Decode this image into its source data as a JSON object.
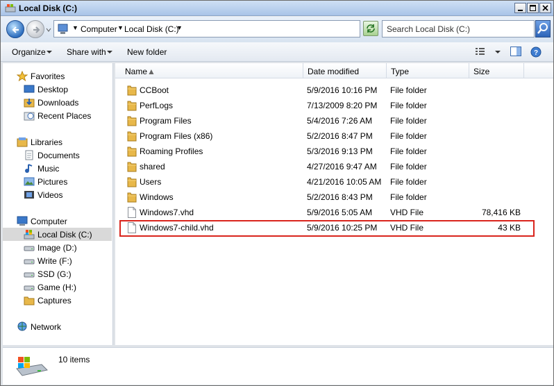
{
  "window": {
    "title": "Local Disk (C:)"
  },
  "address": {
    "crumbs": [
      "Computer",
      "Local Disk (C:)"
    ]
  },
  "search": {
    "placeholder": "Search Local Disk (C:)"
  },
  "toolbar": {
    "organize": "Organize",
    "share_with": "Share with",
    "new_folder": "New folder"
  },
  "nav": {
    "favorites": "Favorites",
    "desktop": "Desktop",
    "downloads": "Downloads",
    "recent_places": "Recent Places",
    "libraries": "Libraries",
    "documents": "Documents",
    "music": "Music",
    "pictures": "Pictures",
    "videos": "Videos",
    "computer": "Computer",
    "local_disk": "Local Disk (C:)",
    "image_d": "Image (D:)",
    "write_f": "Write (F:)",
    "ssd_g": "SSD (G:)",
    "game_h": "Game (H:)",
    "captures": "Captures",
    "network": "Network"
  },
  "columns": {
    "name": "Name",
    "date_modified": "Date modified",
    "type": "Type",
    "size": "Size"
  },
  "files": [
    {
      "name": "CCBoot",
      "date": "5/9/2016 10:16 PM",
      "type": "File folder",
      "size": "",
      "kind": "folder"
    },
    {
      "name": "PerfLogs",
      "date": "7/13/2009 8:20 PM",
      "type": "File folder",
      "size": "",
      "kind": "folder"
    },
    {
      "name": "Program Files",
      "date": "5/4/2016 7:26 AM",
      "type": "File folder",
      "size": "",
      "kind": "folder"
    },
    {
      "name": "Program Files (x86)",
      "date": "5/2/2016 8:47 PM",
      "type": "File folder",
      "size": "",
      "kind": "folder"
    },
    {
      "name": "Roaming Profiles",
      "date": "5/3/2016 9:13 PM",
      "type": "File folder",
      "size": "",
      "kind": "folder"
    },
    {
      "name": "shared",
      "date": "4/27/2016 9:47 AM",
      "type": "File folder",
      "size": "",
      "kind": "folder"
    },
    {
      "name": "Users",
      "date": "4/21/2016 10:05 AM",
      "type": "File folder",
      "size": "",
      "kind": "folder"
    },
    {
      "name": "Windows",
      "date": "5/2/2016 8:43 PM",
      "type": "File folder",
      "size": "",
      "kind": "folder"
    },
    {
      "name": "Windows7.vhd",
      "date": "5/9/2016 5:05 AM",
      "type": "VHD File",
      "size": "78,416 KB",
      "kind": "file"
    },
    {
      "name": "Windows7-child.vhd",
      "date": "5/9/2016 10:25 PM",
      "type": "VHD File",
      "size": "43 KB",
      "kind": "file"
    }
  ],
  "status": {
    "item_count": "10 items"
  },
  "colors": {
    "highlight": "#d9241c",
    "selection": "#d9d9d9",
    "folder": "#e8b84a"
  }
}
